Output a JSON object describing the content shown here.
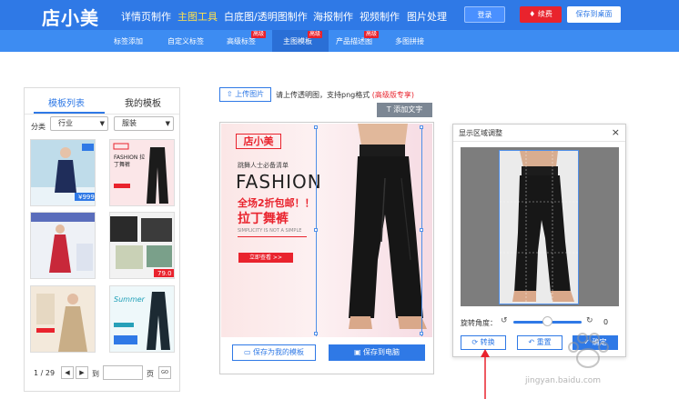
{
  "brand": {
    "logo": "店小美"
  },
  "nav": {
    "items": [
      {
        "label": "详情页制作",
        "active": false
      },
      {
        "label": "主图工具",
        "active": true
      },
      {
        "label": "白底图/透明图制作",
        "active": false
      },
      {
        "label": "海报制作",
        "active": false
      },
      {
        "label": "视频制作",
        "active": false
      },
      {
        "label": "图片处理",
        "active": false
      }
    ],
    "login": "登录",
    "renew": "续费",
    "save_desktop": "保存到桌面"
  },
  "subnav": {
    "items": [
      {
        "label": "标签添加"
      },
      {
        "label": "自定义标签"
      },
      {
        "label": "高级标签",
        "badge": "高级"
      },
      {
        "label": "主图模板",
        "badge": "高级",
        "active": true
      },
      {
        "label": "产品描述图",
        "badge": "高级"
      },
      {
        "label": "多图拼接"
      }
    ]
  },
  "left_panel": {
    "tab_templates": "模板列表",
    "tab_mine": "我的模板",
    "filter_label": "分类",
    "filter_industry": "行业",
    "filter_category": "服装",
    "pager": {
      "current": "1",
      "total": "29",
      "goto": "到",
      "page": "页",
      "go": "GO"
    }
  },
  "thumbnails": [
    {
      "price": "¥999",
      "title": ""
    },
    {
      "title": "FASHION 拉丁舞裤"
    },
    {
      "title": ""
    },
    {
      "price": "79.0",
      "title": ""
    },
    {
      "title": ""
    },
    {
      "title": "Summer"
    }
  ],
  "upload": {
    "button": "上传图片",
    "hint": "请上传透明图，支持png格式",
    "hint_note": "(高级版专享)",
    "add_text": "添加文字"
  },
  "poster": {
    "logo": "店小美",
    "subtitle": "跳舞人士必备清单",
    "headline": "FASHION",
    "promo": "全场2折包邮！！",
    "product": "拉丁舞裤",
    "tagline": "SIMPLICITY IS NOT A SIMPLE",
    "cta": "立即查看 >>"
  },
  "canvas_actions": {
    "save_template": "保存为我的模板",
    "save_computer": "保存到电脑"
  },
  "dialog": {
    "title": "显示区域调整",
    "rotate_label": "旋转角度：",
    "rotate_value": "0",
    "swap": "转换",
    "reset": "重置",
    "confirm": "确定"
  },
  "watermark": "jingyan.baidu.com",
  "colors": {
    "primary": "#2f79e6",
    "accent_red": "#e9232d",
    "nav_active": "#ffe14b"
  }
}
